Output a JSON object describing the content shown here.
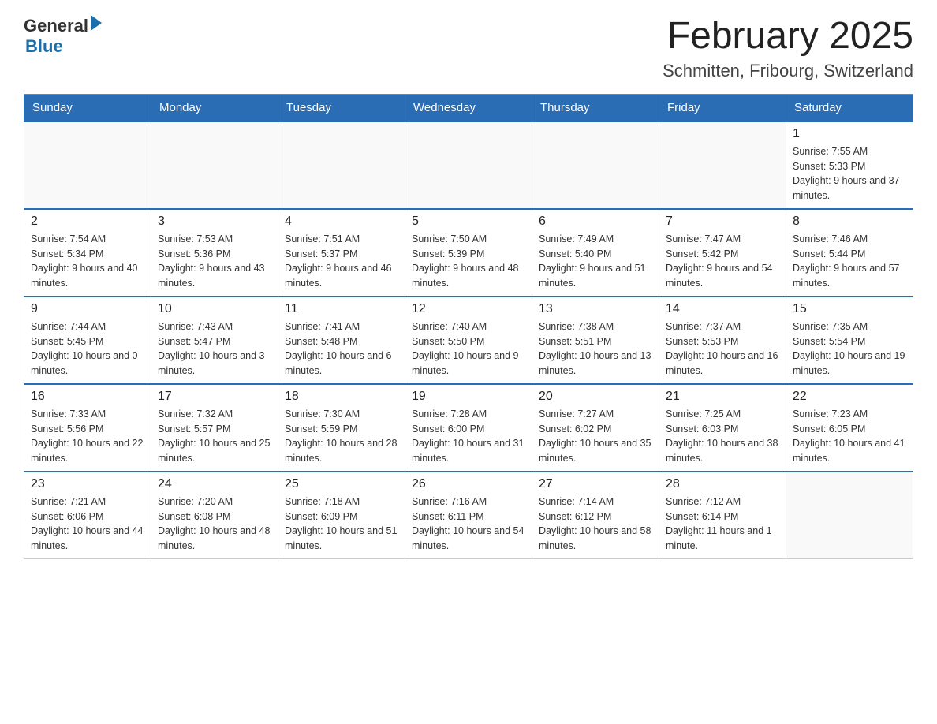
{
  "header": {
    "logo_general": "General",
    "logo_arrow": "▶",
    "logo_blue": "Blue",
    "month_title": "February 2025",
    "location": "Schmitten, Fribourg, Switzerland"
  },
  "days_of_week": [
    "Sunday",
    "Monday",
    "Tuesday",
    "Wednesday",
    "Thursday",
    "Friday",
    "Saturday"
  ],
  "weeks": [
    {
      "days": [
        {
          "num": "",
          "info": ""
        },
        {
          "num": "",
          "info": ""
        },
        {
          "num": "",
          "info": ""
        },
        {
          "num": "",
          "info": ""
        },
        {
          "num": "",
          "info": ""
        },
        {
          "num": "",
          "info": ""
        },
        {
          "num": "1",
          "info": "Sunrise: 7:55 AM\nSunset: 5:33 PM\nDaylight: 9 hours and 37 minutes."
        }
      ]
    },
    {
      "days": [
        {
          "num": "2",
          "info": "Sunrise: 7:54 AM\nSunset: 5:34 PM\nDaylight: 9 hours and 40 minutes."
        },
        {
          "num": "3",
          "info": "Sunrise: 7:53 AM\nSunset: 5:36 PM\nDaylight: 9 hours and 43 minutes."
        },
        {
          "num": "4",
          "info": "Sunrise: 7:51 AM\nSunset: 5:37 PM\nDaylight: 9 hours and 46 minutes."
        },
        {
          "num": "5",
          "info": "Sunrise: 7:50 AM\nSunset: 5:39 PM\nDaylight: 9 hours and 48 minutes."
        },
        {
          "num": "6",
          "info": "Sunrise: 7:49 AM\nSunset: 5:40 PM\nDaylight: 9 hours and 51 minutes."
        },
        {
          "num": "7",
          "info": "Sunrise: 7:47 AM\nSunset: 5:42 PM\nDaylight: 9 hours and 54 minutes."
        },
        {
          "num": "8",
          "info": "Sunrise: 7:46 AM\nSunset: 5:44 PM\nDaylight: 9 hours and 57 minutes."
        }
      ]
    },
    {
      "days": [
        {
          "num": "9",
          "info": "Sunrise: 7:44 AM\nSunset: 5:45 PM\nDaylight: 10 hours and 0 minutes."
        },
        {
          "num": "10",
          "info": "Sunrise: 7:43 AM\nSunset: 5:47 PM\nDaylight: 10 hours and 3 minutes."
        },
        {
          "num": "11",
          "info": "Sunrise: 7:41 AM\nSunset: 5:48 PM\nDaylight: 10 hours and 6 minutes."
        },
        {
          "num": "12",
          "info": "Sunrise: 7:40 AM\nSunset: 5:50 PM\nDaylight: 10 hours and 9 minutes."
        },
        {
          "num": "13",
          "info": "Sunrise: 7:38 AM\nSunset: 5:51 PM\nDaylight: 10 hours and 13 minutes."
        },
        {
          "num": "14",
          "info": "Sunrise: 7:37 AM\nSunset: 5:53 PM\nDaylight: 10 hours and 16 minutes."
        },
        {
          "num": "15",
          "info": "Sunrise: 7:35 AM\nSunset: 5:54 PM\nDaylight: 10 hours and 19 minutes."
        }
      ]
    },
    {
      "days": [
        {
          "num": "16",
          "info": "Sunrise: 7:33 AM\nSunset: 5:56 PM\nDaylight: 10 hours and 22 minutes."
        },
        {
          "num": "17",
          "info": "Sunrise: 7:32 AM\nSunset: 5:57 PM\nDaylight: 10 hours and 25 minutes."
        },
        {
          "num": "18",
          "info": "Sunrise: 7:30 AM\nSunset: 5:59 PM\nDaylight: 10 hours and 28 minutes."
        },
        {
          "num": "19",
          "info": "Sunrise: 7:28 AM\nSunset: 6:00 PM\nDaylight: 10 hours and 31 minutes."
        },
        {
          "num": "20",
          "info": "Sunrise: 7:27 AM\nSunset: 6:02 PM\nDaylight: 10 hours and 35 minutes."
        },
        {
          "num": "21",
          "info": "Sunrise: 7:25 AM\nSunset: 6:03 PM\nDaylight: 10 hours and 38 minutes."
        },
        {
          "num": "22",
          "info": "Sunrise: 7:23 AM\nSunset: 6:05 PM\nDaylight: 10 hours and 41 minutes."
        }
      ]
    },
    {
      "days": [
        {
          "num": "23",
          "info": "Sunrise: 7:21 AM\nSunset: 6:06 PM\nDaylight: 10 hours and 44 minutes."
        },
        {
          "num": "24",
          "info": "Sunrise: 7:20 AM\nSunset: 6:08 PM\nDaylight: 10 hours and 48 minutes."
        },
        {
          "num": "25",
          "info": "Sunrise: 7:18 AM\nSunset: 6:09 PM\nDaylight: 10 hours and 51 minutes."
        },
        {
          "num": "26",
          "info": "Sunrise: 7:16 AM\nSunset: 6:11 PM\nDaylight: 10 hours and 54 minutes."
        },
        {
          "num": "27",
          "info": "Sunrise: 7:14 AM\nSunset: 6:12 PM\nDaylight: 10 hours and 58 minutes."
        },
        {
          "num": "28",
          "info": "Sunrise: 7:12 AM\nSunset: 6:14 PM\nDaylight: 11 hours and 1 minute."
        },
        {
          "num": "",
          "info": ""
        }
      ]
    }
  ]
}
